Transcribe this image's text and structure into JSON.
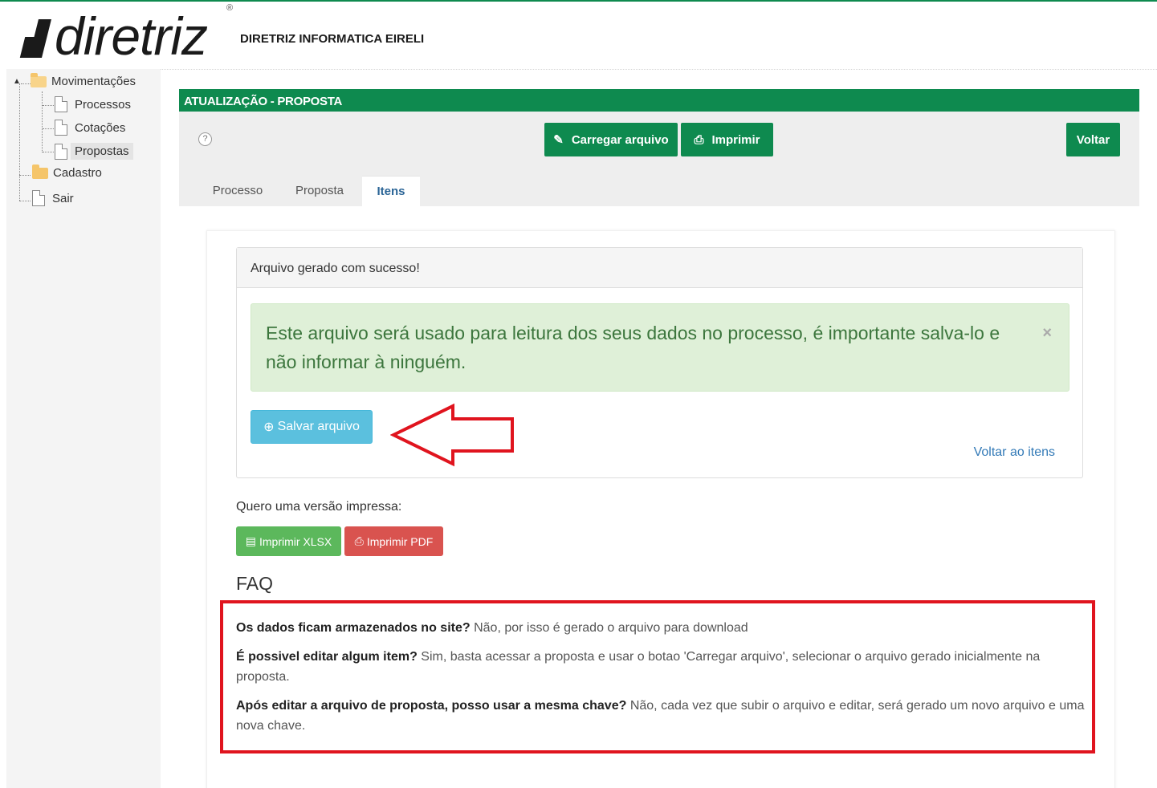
{
  "header": {
    "brand_word": "diretriz",
    "brand_reg": "®",
    "company_name": "DIRETRIZ INFORMATICA EIRELI"
  },
  "sidebar": {
    "items": [
      {
        "label": "Movimentações",
        "icon": "folder-open-icon"
      },
      {
        "label": "Processos",
        "icon": "file-icon"
      },
      {
        "label": "Cotações",
        "icon": "file-icon"
      },
      {
        "label": "Propostas",
        "icon": "file-icon",
        "selected": true
      },
      {
        "label": "Cadastro",
        "icon": "folder-icon"
      },
      {
        "label": "Sair",
        "icon": "file-icon"
      }
    ]
  },
  "panel": {
    "title": "ATUALIZAÇÃO - PROPOSTA",
    "help_glyph": "?",
    "toolbar": {
      "load_label": "Carregar arquivo",
      "print_label": "Imprimir",
      "back_label": "Voltar"
    },
    "tabs": [
      {
        "label": "Processo",
        "active": false
      },
      {
        "label": "Proposta",
        "active": false
      },
      {
        "label": "Itens",
        "active": true
      }
    ]
  },
  "success": {
    "heading": "Arquivo gerado com sucesso!",
    "alert_text": "Este arquivo será usado para leitura dos seus dados no processo, é importante salva-lo e não informar à ninguém.",
    "close_glyph": "×",
    "save_label": "Salvar arquivo",
    "back_link": "Voltar ao itens"
  },
  "print": {
    "label": "Quero uma versão impressa:",
    "xlsx_label": "Imprimir XLSX",
    "pdf_label": "Imprimir PDF"
  },
  "faq": {
    "title": "FAQ",
    "items": [
      {
        "q": "Os dados ficam armazenados no site?",
        "a": " Não, por isso é gerado o arquivo para download"
      },
      {
        "q": "É possivel editar algum item?",
        "a": " Sim, basta acessar a proposta e usar o botao 'Carregar arquivo', selecionar o arquivo gerado inicialmente na proposta."
      },
      {
        "q": "Após editar a arquivo de proposta, posso usar a mesma chave?",
        "a": " Não, cada vez que subir o arquivo e editar, será gerado um novo arquivo e uma nova chave."
      }
    ]
  },
  "colors": {
    "brand_green": "#0e8a4f",
    "info_blue": "#5bc0de",
    "success_green": "#5cb85c",
    "danger_red": "#d9534f",
    "annotation_red": "#e0141e"
  }
}
